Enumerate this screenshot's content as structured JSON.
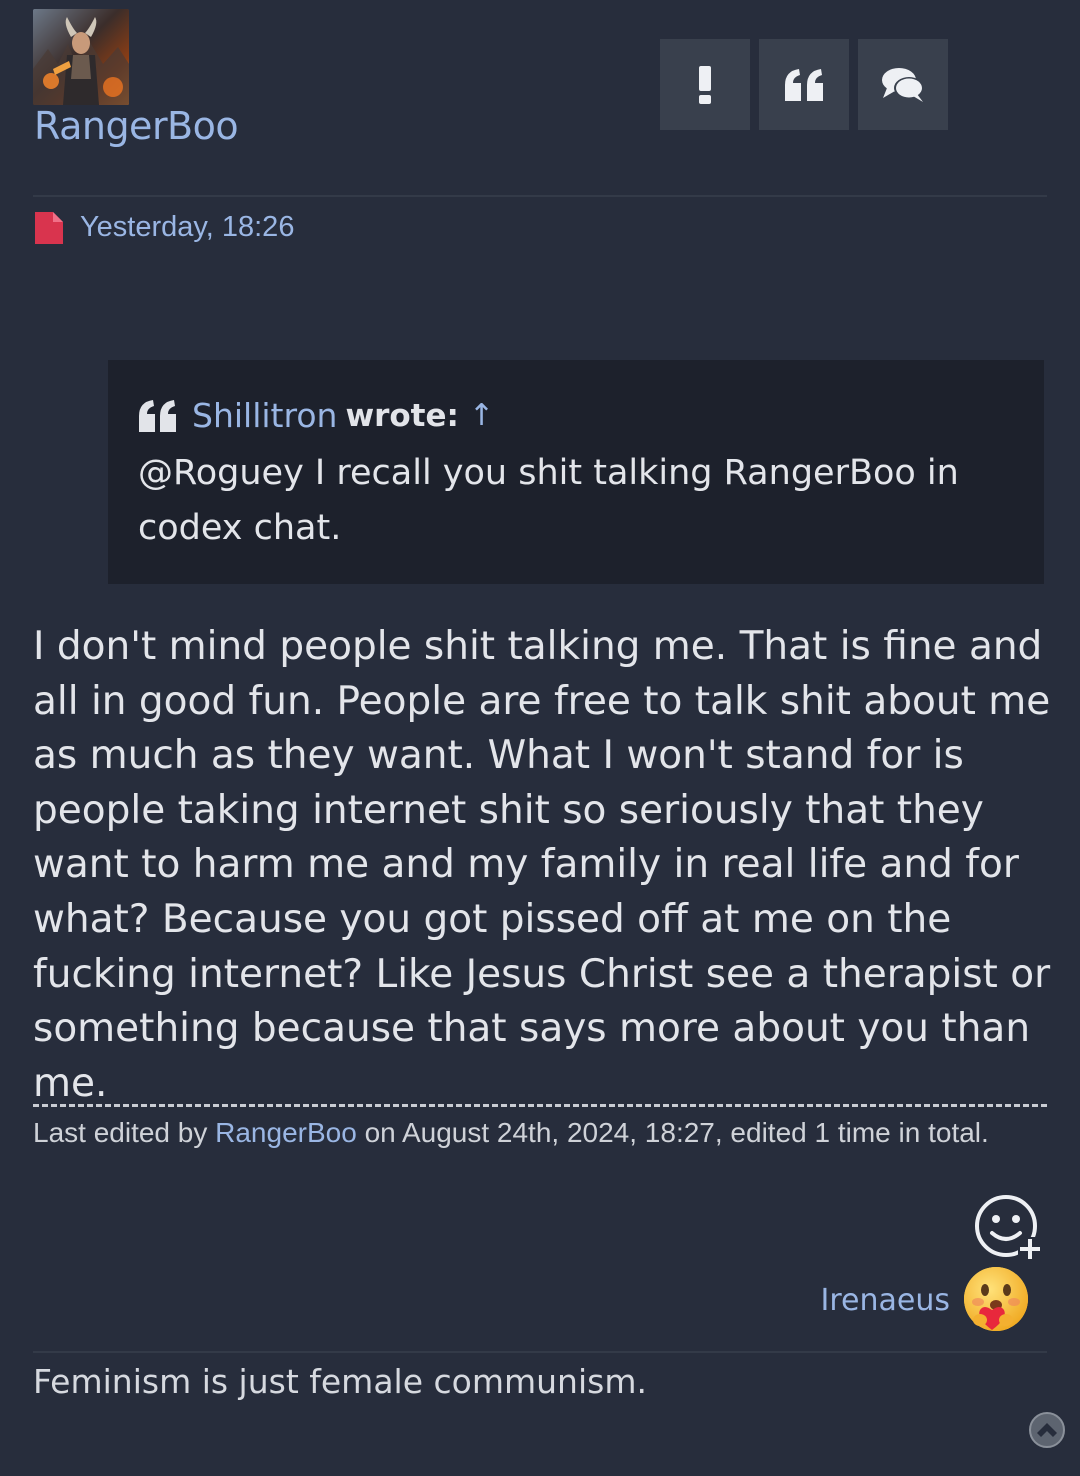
{
  "author": {
    "username": "RangerBoo",
    "avatar_icon": "avatar-image"
  },
  "actions": {
    "report_icon": "exclamation-icon",
    "quote_icon": "quote-icon",
    "reply_icon": "comments-icon",
    "report_label": "!"
  },
  "meta": {
    "timestamp": "Yesterday, 18:26",
    "post_icon": "file-icon"
  },
  "quote": {
    "author": "Shillitron",
    "wrote": "wrote:",
    "arrow": "↑",
    "text": "@Roguey I recall you shit talking RangerBoo in codex chat."
  },
  "body": {
    "text": "I don't mind people shit talking me. That is fine and all in good fun. People are free to talk shit about me as much as they want. What I won't stand for is people taking internet shit so seriously that they want to harm me and my family in real life and for what? Because you got pissed off at me on the fucking internet? Like Jesus Christ see a therapist or something because that says more about you than me."
  },
  "edit_note": {
    "prefix": "Last edited by",
    "editor": "RangerBoo",
    "suffix": "on August 24th, 2024, 18:27, edited 1 time in total."
  },
  "reactions": {
    "add_icon": "add-reaction-icon",
    "reactor": "Irenaeus",
    "emoji_icon": "hugging-heart-emoji"
  },
  "signature": "Feminism is just female communism.",
  "colors": {
    "background": "#272d3c",
    "link": "#9ab6e4",
    "quote_bg": "#1d212c",
    "button_bg": "#39404d",
    "post_icon": "#d9344e"
  }
}
